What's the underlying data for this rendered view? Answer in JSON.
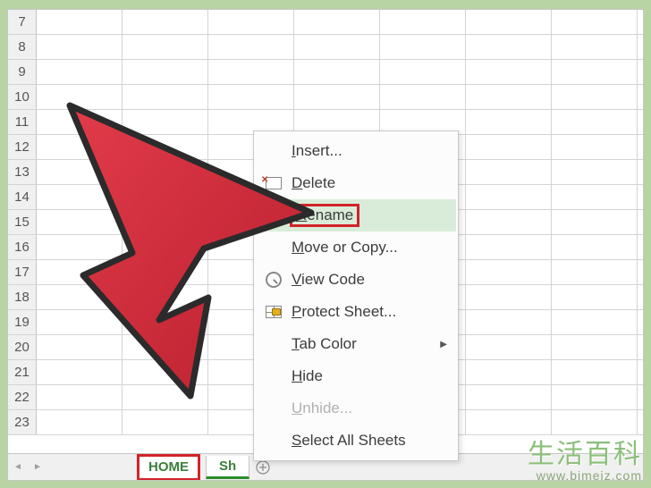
{
  "rows": [
    7,
    8,
    9,
    10,
    11,
    12,
    13,
    14,
    15,
    16,
    17,
    18,
    19,
    20,
    21,
    22,
    23
  ],
  "tabs": {
    "home": "HOME",
    "sheet2": "Sh"
  },
  "context_menu": {
    "insert": "Insert...",
    "delete": "Delete",
    "rename": "Rename",
    "move_copy": "Move or Copy...",
    "view_code": "View Code",
    "protect": "Protect Sheet...",
    "tab_color": "Tab Color",
    "hide": "Hide",
    "unhide": "Unhide...",
    "select_all": "Select All Sheets"
  },
  "watermark": {
    "cn": "生活百科",
    "url": "www.bimeiz.com"
  }
}
